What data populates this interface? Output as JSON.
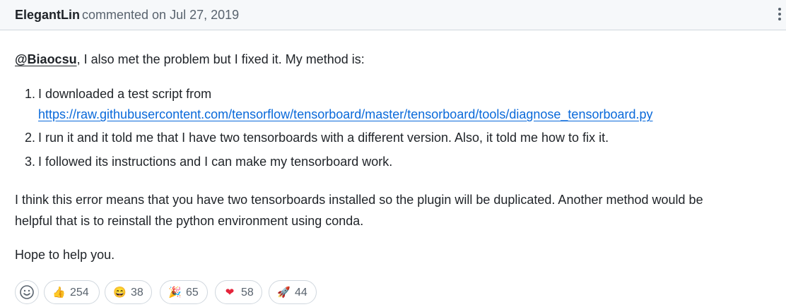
{
  "comment": {
    "author": "ElegantLin",
    "meta": "commented on Jul 27, 2019",
    "menu_icon": "kebab-horizontal-icon",
    "mention": "@Biaocsu",
    "intro_rest": ", I also met the problem but I fixed it. My method is:",
    "steps": [
      {
        "num": "1.",
        "text": "I downloaded a test script from",
        "link": "https://raw.githubusercontent.com/tensorflow/tensorboard/master/tensorboard/tools/diagnose_tensorboard.py"
      },
      {
        "num": "2.",
        "text": "I run it and it told me that I have two tensorboards with a different version. Also, it told me how to fix it."
      },
      {
        "num": "3.",
        "text": "I followed its instructions and I can make my tensorboard work."
      }
    ],
    "para_line1": "I think this error means that you have two tensorboards installed so the plugin will be duplicated. Another method would be",
    "para_line2": "helpful that is to reinstall the python environment using conda.",
    "closing": "Hope to help you."
  },
  "reactions": {
    "add_icon": "smiley-icon",
    "items": [
      {
        "icon": "thumbs-up-icon",
        "emoji": "👍",
        "count": "254"
      },
      {
        "icon": "laugh-icon",
        "emoji": "😄",
        "count": "38"
      },
      {
        "icon": "hooray-icon",
        "emoji": "🎉",
        "count": "65"
      },
      {
        "icon": "heart-icon",
        "emoji": "❤",
        "count": "58"
      },
      {
        "icon": "rocket-icon",
        "emoji": "🚀",
        "count": "44"
      }
    ]
  },
  "colors": {
    "header_bg": "#f6f8fa",
    "border": "#d0d7de",
    "link": "#0969da",
    "muted": "#59636e",
    "text": "#1f2328",
    "heart": "#e5243b"
  }
}
